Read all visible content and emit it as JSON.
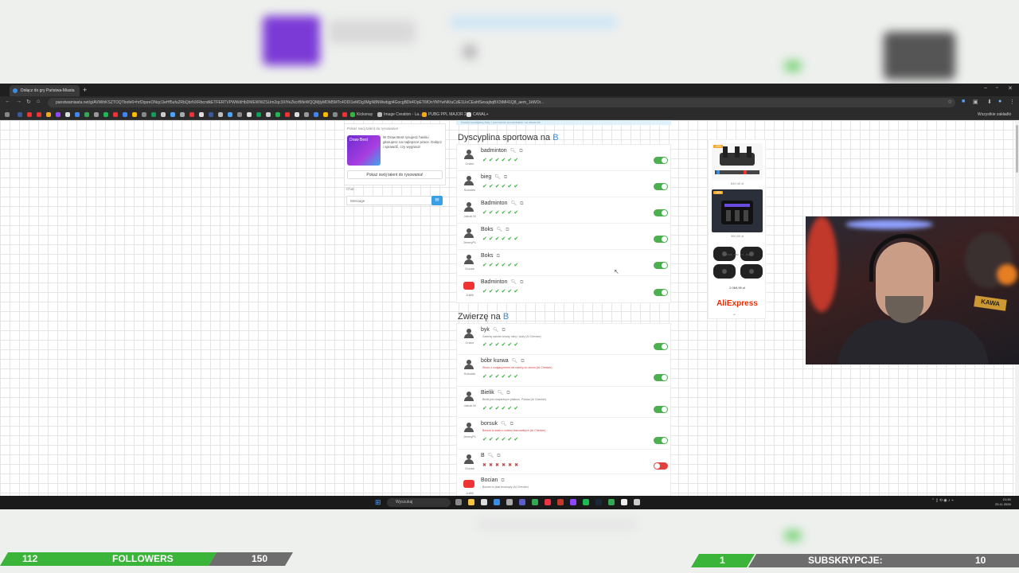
{
  "browser": {
    "tab_title": "Dołącz do gry Państwa-Miasta",
    "url": "panstwamiasta.net/g/AVWihKSZTOQTbofe6=hrf2qsreONqc1leHf5ufu2RbQbrNXRbcndkETFERTVPWWdHbDMEWWZSUm2qc3XlYeZkcrBlfeWQQMjlyMDM5MTc4ODI1eMDg3MgN8NWwbjgt4GocgBDk4OpET6fOnYMYwNKtuCdE1UoCEahfSexajbqBX3tMl41Q8_aem_1kWOr..."
  },
  "bookmarks": {
    "items": [
      "Kickonay",
      "Image Creation - La...",
      "PUBG PPL MAJOR 2...",
      "CANAL+"
    ],
    "all_bookmarks": "Wszystkie zakładki"
  },
  "info_strip": "Dodaj rozwijaną listę i ponownie poczekanie na otwarcie",
  "promo": {
    "label": "Pokaż swój talent do rysowania!",
    "img_text": "Draw Best",
    "text": "W Draw Best rysujesz hasła i głosujesz na najlepsze prace. Dołącz i sprawdź, czy wygrasz!",
    "button": "Pokaż swój talent do rysowania!"
  },
  "chat": {
    "label": "Chat",
    "placeholder": "Message"
  },
  "sections": [
    {
      "title": "Dyscyplina sportowa na ",
      "letter": "B",
      "rows": [
        {
          "player": "Crane",
          "word": "badminton"
        },
        {
          "player": "Sobolek",
          "word": "bieg"
        },
        {
          "player": "Jakub M",
          "word": "Badminton"
        },
        {
          "player": "JimmyPL",
          "word": "Boks"
        },
        {
          "player": "Goose",
          "word": "Boks"
        },
        {
          "player": "Jullf8",
          "word": "Badminton"
        }
      ]
    },
    {
      "title": "Zwierzę na ",
      "letter": "B",
      "rows": [
        {
          "player": "Crane",
          "word": "byk",
          "note": "Zwierzę samiec krowy, silny i duży (AI Checker)"
        },
        {
          "player": "Sobolek",
          "word": "bóbr kurwa",
          "note": "Słowo z wulgaryzmem nie należy do zbioru (AI Checker)"
        },
        {
          "player": "Jakub M",
          "word": "Bielik",
          "note": "Bielik jest drapieżnym ptakiem, Polska (AI Checker)"
        },
        {
          "player": "JimmyPL",
          "word": "borsuk",
          "note": "Borsuk to ssak z rodziny łasicowatych (AI Checker)"
        },
        {
          "player": "Goose",
          "word": "B"
        },
        {
          "player": "Jullf8",
          "word": "Bocian",
          "note": "Bocian to ptak brodzący (AI Checker)"
        }
      ]
    }
  ],
  "ads": {
    "prod1_badge": "-23%",
    "prod1_price": "649,40 zł",
    "prod2_badge": "-18%",
    "prod2_price": "390,59 zł",
    "prod3_price": "2 069,99 zł",
    "prod3_labels": [
      "SX-628",
      "R82",
      "P1",
      "R12"
    ],
    "brand": "AliExpress"
  },
  "webcam": {
    "sign": "KAWA"
  },
  "taskbar": {
    "search": "Wyszukaj",
    "time": "21:30",
    "date": "25.11.2026"
  },
  "followers": {
    "current": "112",
    "label": "FOLLOWERS",
    "goal": "150",
    "progress": 0.75
  },
  "subscriptions": {
    "current": "1",
    "label": "SUBSKRYPCJE:",
    "goal": "10",
    "progress": 0.1
  },
  "colors": {
    "accent_green": "#3ab53a",
    "letter_blue": "#2f8fe0",
    "toggle_on": "#4caf50",
    "toggle_off": "#e04040",
    "aliexpress": "#e62e04"
  }
}
